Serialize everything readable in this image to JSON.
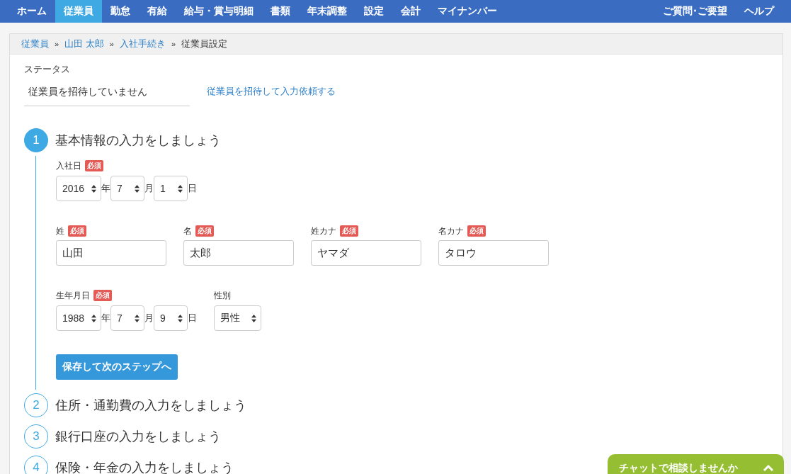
{
  "nav": {
    "items": [
      {
        "label": "ホーム",
        "selected": false
      },
      {
        "label": "従業員",
        "selected": true
      },
      {
        "label": "勤怠",
        "selected": false
      },
      {
        "label": "有給",
        "selected": false
      },
      {
        "label": "給与・賞与明細",
        "selected": false
      },
      {
        "label": "書類",
        "selected": false
      },
      {
        "label": "年末調整",
        "selected": false
      },
      {
        "label": "設定",
        "selected": false
      },
      {
        "label": "会計",
        "selected": false
      },
      {
        "label": "マイナンバー",
        "selected": false
      }
    ],
    "right_links": [
      "ご質問･ご要望",
      "ヘルプ"
    ]
  },
  "breadcrumb": {
    "separator": "»",
    "items": [
      {
        "label": "従業員",
        "kind": "link"
      },
      {
        "label": "山田 太郎",
        "kind": "link"
      },
      {
        "label": "入社手続き",
        "kind": "link"
      },
      {
        "label": "従業員設定",
        "kind": "current"
      }
    ]
  },
  "status": {
    "label": "ステータス",
    "value": "従業員を招待していません",
    "invite_link": "従業員を招待して入力依頼する"
  },
  "steps": [
    {
      "number": "1",
      "title": "基本情報の入力をしましょう",
      "selected": true,
      "form": {
        "join_date": {
          "label": "入社日",
          "badge": "必須",
          "parts": [
            {
              "value": "2016",
              "unit": "年"
            },
            {
              "value": "7",
              "unit": "月"
            },
            {
              "value": "1",
              "unit": "日"
            }
          ]
        },
        "names": [
          {
            "label": "姓",
            "badge": "必須",
            "value": "山田"
          },
          {
            "label": "名",
            "badge": "必須",
            "value": "太郎"
          },
          {
            "label": "姓カナ",
            "badge": "必須",
            "value": "ヤマダ"
          },
          {
            "label": "名カナ",
            "badge": "必須",
            "value": "タロウ"
          }
        ],
        "birth_date": {
          "label": "生年月日",
          "badge": "必須",
          "parts": [
            {
              "value": "1988",
              "unit": "年"
            },
            {
              "value": "7",
              "unit": "月"
            },
            {
              "value": "9",
              "unit": "日"
            }
          ]
        },
        "gender": {
          "label": "性別",
          "value": "男性"
        },
        "submit": "保存して次のステップへ"
      }
    },
    {
      "number": "2",
      "title": "住所・通勤費の入力をしましょう",
      "selected": false
    },
    {
      "number": "3",
      "title": "銀行口座の入力をしましょう",
      "selected": false
    },
    {
      "number": "4",
      "title": "保険・年金の入力をしましょう",
      "selected": false
    }
  ],
  "chat": {
    "label": "チャットで相談しませんか"
  }
}
